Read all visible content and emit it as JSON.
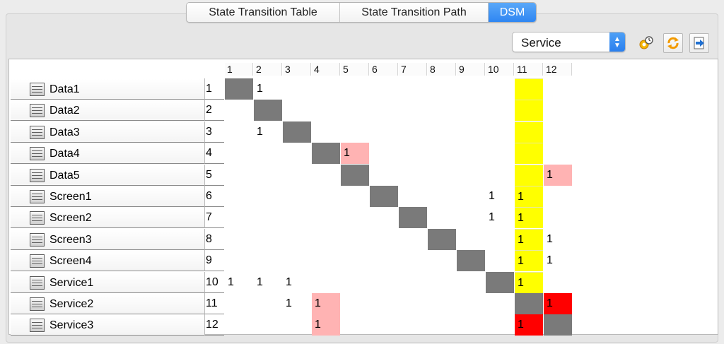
{
  "tabs": [
    "State Transition Table",
    "State Transition Path",
    "DSM"
  ],
  "active_tab": 2,
  "select": {
    "value": "Service"
  },
  "toolbar_icons": [
    "cluster-settings-icon",
    "refresh-icon",
    "export-icon"
  ],
  "columns": [
    "1",
    "2",
    "3",
    "4",
    "5",
    "6",
    "7",
    "8",
    "9",
    "10",
    "11",
    "12"
  ],
  "rows": [
    {
      "label": "Data1",
      "num": "1"
    },
    {
      "label": "Data2",
      "num": "2"
    },
    {
      "label": "Data3",
      "num": "3"
    },
    {
      "label": "Data4",
      "num": "4"
    },
    {
      "label": "Data5",
      "num": "5"
    },
    {
      "label": "Screen1",
      "num": "6"
    },
    {
      "label": "Screen2",
      "num": "7"
    },
    {
      "label": "Screen3",
      "num": "8"
    },
    {
      "label": "Screen4",
      "num": "9"
    },
    {
      "label": "Service1",
      "num": "10"
    },
    {
      "label": "Service2",
      "num": "11"
    },
    {
      "label": "Service3",
      "num": "12"
    }
  ],
  "cells": [
    {
      "r": 0,
      "c": 0,
      "style": "diag",
      "text": ""
    },
    {
      "r": 0,
      "c": 1,
      "style": "",
      "text": "1"
    },
    {
      "r": 1,
      "c": 1,
      "style": "diag",
      "text": ""
    },
    {
      "r": 2,
      "c": 1,
      "style": "",
      "text": "1"
    },
    {
      "r": 2,
      "c": 2,
      "style": "diag",
      "text": ""
    },
    {
      "r": 3,
      "c": 3,
      "style": "diag",
      "text": ""
    },
    {
      "r": 3,
      "c": 4,
      "style": "pink",
      "text": "1"
    },
    {
      "r": 4,
      "c": 4,
      "style": "diag",
      "text": ""
    },
    {
      "r": 4,
      "c": 11,
      "style": "pink",
      "text": "1"
    },
    {
      "r": 5,
      "c": 5,
      "style": "diag",
      "text": ""
    },
    {
      "r": 5,
      "c": 9,
      "style": "",
      "text": "1"
    },
    {
      "r": 6,
      "c": 6,
      "style": "diag",
      "text": ""
    },
    {
      "r": 6,
      "c": 9,
      "style": "",
      "text": "1"
    },
    {
      "r": 7,
      "c": 7,
      "style": "diag",
      "text": ""
    },
    {
      "r": 7,
      "c": 11,
      "style": "",
      "text": "1"
    },
    {
      "r": 8,
      "c": 8,
      "style": "diag",
      "text": ""
    },
    {
      "r": 8,
      "c": 11,
      "style": "",
      "text": "1"
    },
    {
      "r": 9,
      "c": 0,
      "style": "",
      "text": "1"
    },
    {
      "r": 9,
      "c": 1,
      "style": "",
      "text": "1"
    },
    {
      "r": 9,
      "c": 2,
      "style": "",
      "text": "1"
    },
    {
      "r": 9,
      "c": 9,
      "style": "diag",
      "text": ""
    },
    {
      "r": 10,
      "c": 2,
      "style": "",
      "text": "1"
    },
    {
      "r": 10,
      "c": 3,
      "style": "pink",
      "text": "1"
    },
    {
      "r": 10,
      "c": 10,
      "style": "grey",
      "text": ""
    },
    {
      "r": 10,
      "c": 11,
      "style": "red",
      "text": "1"
    },
    {
      "r": 11,
      "c": 3,
      "style": "pink",
      "text": "1"
    },
    {
      "r": 11,
      "c": 10,
      "style": "red",
      "text": "1"
    },
    {
      "r": 11,
      "c": 11,
      "style": "grey",
      "text": ""
    }
  ],
  "yellow_column": {
    "col": 10,
    "rows": [
      0,
      1,
      2,
      3,
      4,
      5,
      6,
      7,
      8,
      9
    ],
    "values": {
      "5": "1",
      "6": "1",
      "7": "1",
      "8": "1",
      "9": "1"
    }
  },
  "colors": {
    "diagonal": "#7a7a7a",
    "highlight": "#ffff00",
    "pink": "#ffb3b3",
    "red": "#ff0000",
    "accent": "#2f86f2"
  }
}
